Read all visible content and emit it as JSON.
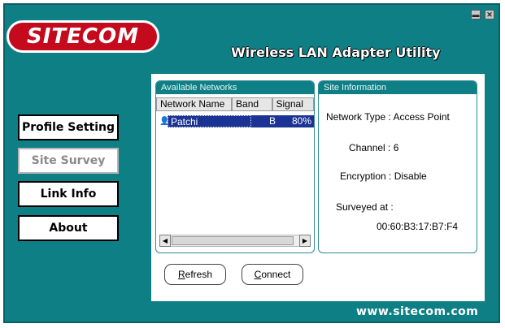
{
  "app": {
    "brand": "SITECOM",
    "title": "Wireless LAN Adapter Utility",
    "footer_url": "www.sitecom.com",
    "colors": {
      "background": "#0f7f86",
      "brand_red": "#c40a1c",
      "selection": "#1a3394"
    }
  },
  "window_controls": {
    "minimize_icon": "minimize-icon",
    "close_icon": "close-icon"
  },
  "nav": {
    "profile_setting": "Profile Setting",
    "site_survey": "Site Survey",
    "link_info": "Link Info",
    "about": "About",
    "active": "Site Survey"
  },
  "networks": {
    "header": "Available Networks",
    "columns": [
      "Network Name",
      "Band",
      "Signal"
    ],
    "rows": [
      {
        "name": "Patchi",
        "band": "B",
        "signal": "80%",
        "selected": true
      }
    ]
  },
  "site_info": {
    "header": "Site Information",
    "network_type": "Network Type : Access Point",
    "channel": "Channel : 6",
    "encryption": "Encryption : Disable",
    "surveyed_label": "Surveyed at :",
    "mac": "00:60:B3:17:B7:F4"
  },
  "buttons": {
    "refresh_first": "R",
    "refresh_rest": "efresh",
    "connect_first": "C",
    "connect_rest": "onnect"
  }
}
